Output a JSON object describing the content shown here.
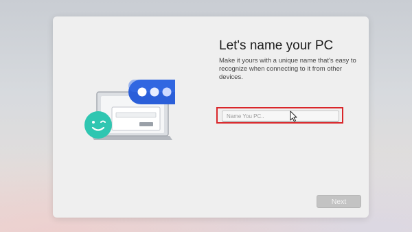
{
  "page": {
    "title": "Let's name your PC",
    "description": "Make it yours with a unique name that's easy to recognize when connecting to it from other devices."
  },
  "name_field": {
    "placeholder": "Name You PC..",
    "value": ""
  },
  "actions": {
    "next_label": "Next"
  },
  "icons": {
    "illustration": "laptop-chat-illustration",
    "cursor": "mouse-pointer-icon"
  },
  "colors": {
    "highlight_border": "#d9262a",
    "chat_bubble": "#2b5fd9",
    "avatar": "#2fc6b1",
    "next_button_disabled": "#c3c3c3"
  }
}
